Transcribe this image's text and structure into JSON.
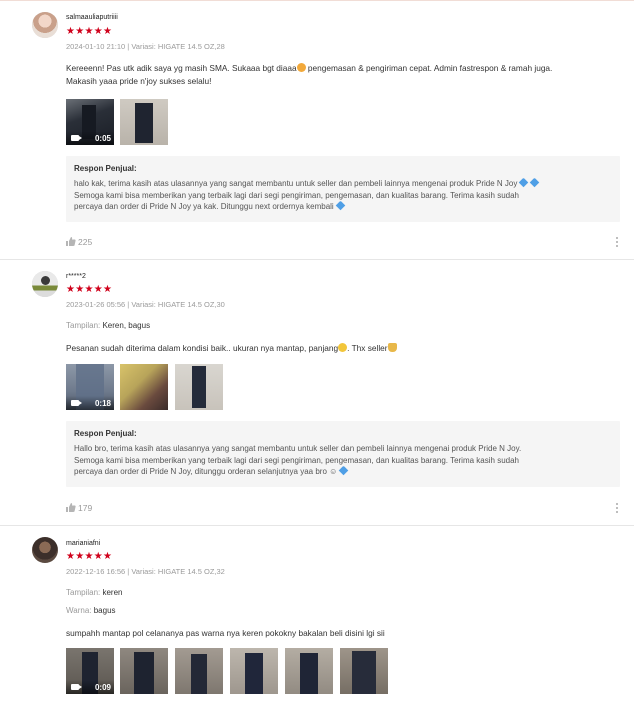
{
  "reviews": [
    {
      "username": "salmaauliaputriiii",
      "stars": "★★★★★",
      "meta": "2024-01-10 21:10 | Variasi: HIGATE 14.5 OZ,28",
      "comment_line1_a": "Kereeenn! Pas utk adik saya yg masih SMA. Sukaaa bgt diaaa",
      "comment_line1_b": " pengemasan & pengiriman cepat. Admin fastrespon & ramah juga.",
      "comment_line2": "Makasih yaaa pride n'joy sukses selalu!",
      "video_duration": "0:05",
      "reply_title": "Respon Penjual:",
      "reply_line1": "halo kak, terima kasih atas ulasannya yang sangat membantu untuk seller dan pembeli lainnya mengenai produk Pride N Joy",
      "reply_line2": "Semoga kami bisa memberikan yang terbaik lagi dari segi pengiriman, pengemasan, dan kualitas barang. Terima kasih sudah",
      "reply_line3": "percaya dan order di Pride N Joy ya kak. Ditunggu next ordernya kembali",
      "likes": "225"
    },
    {
      "username": "r*****2",
      "stars": "★★★★★",
      "meta": "2023-01-26 05:56 | Variasi: HIGATE 14.5 OZ,30",
      "field1_key": "Tampilan:",
      "field1_val": " Keren, bagus",
      "comment_a": "Pesanan sudah diterima dalam kondisi baik.. ukuran nya mantap, panjang",
      "comment_b": ". Thx seller",
      "video_duration": "0:18",
      "reply_title": "Respon Penjual:",
      "reply_line1": "Hallo bro, terima kasih atas ulasannya yang sangat membantu untuk seller dan pembeli lainnya mengenai produk Pride N Joy.",
      "reply_line2": "Semoga kami bisa memberikan yang terbaik lagi dari segi pengiriman, pengemasan, dan kualitas barang. Terima kasih sudah",
      "reply_line3": "percaya dan order di Pride N Joy, ditunggu orderan selanjutnya yaa bro ☺",
      "likes": "179"
    },
    {
      "username": "marianiafni",
      "stars": "★★★★★",
      "meta": "2022-12-16 16:56 | Variasi: HIGATE 14.5 OZ,32",
      "field1_key": "Tampilan:",
      "field1_val": " keren",
      "field2_key": "Warna:",
      "field2_val": " bagus",
      "comment": "sumpahh mantap pol celananya pas warna nya keren pokokny bakalan beli disini lgi sii",
      "video_duration": "0:09"
    }
  ],
  "colors": {
    "star": "#d0011b",
    "muted": "#9a9a9a",
    "reply_bg": "#f5f5f5"
  }
}
